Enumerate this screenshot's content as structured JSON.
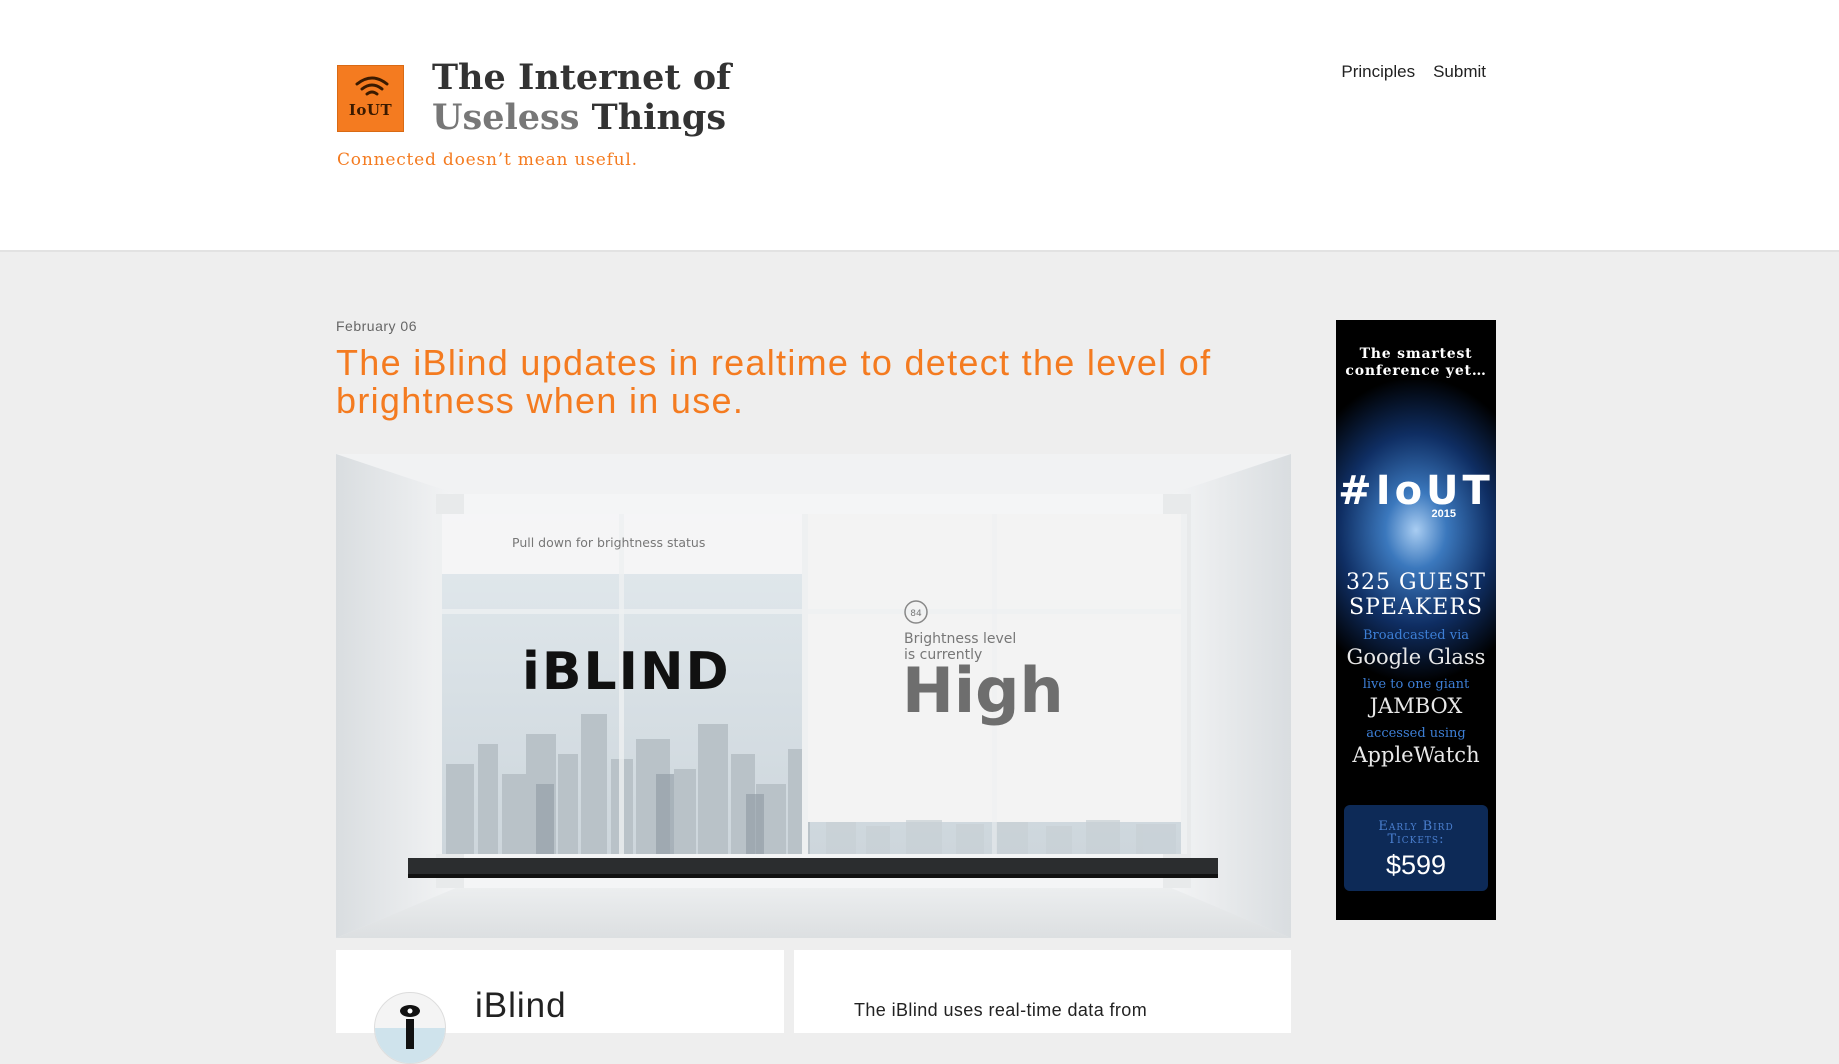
{
  "header": {
    "logo_text": "IoUT",
    "title_line1": "The Internet of",
    "title_line2a": "Useless",
    "title_line2b": "Things",
    "tagline": "Connected doesn’t mean useful.",
    "nav": [
      "Principles",
      "Submit"
    ]
  },
  "post": {
    "date": "February 06",
    "title": "The iBlind updates in realtime to detect the level of brightness when in use.",
    "image": {
      "pull_text": "Pull down for brightness status",
      "brand": "iBLIND",
      "badge_value": "84",
      "level_caption_1": "Brightness level",
      "level_caption_2": "is currently",
      "level_value": "High"
    }
  },
  "ad": {
    "headline_1": "The smartest",
    "headline_2": "conference yet…",
    "hashtag": "#IoUT",
    "year": "2015",
    "speakers_1": "325 GUEST",
    "speakers_2": "SPEAKERS",
    "line1_small": "Broadcasted via",
    "line1_big": "Google Glass",
    "line2_small": "live to one giant",
    "line2_big": "JAMBOX",
    "line3_small": "accessed using",
    "line3_big": "AppleWatch",
    "ticket_label_1": "Early Bird",
    "ticket_label_2": "Tickets:",
    "ticket_price": "$599"
  },
  "product": {
    "name": "iBlind",
    "description": "The iBlind uses real-time data from"
  }
}
